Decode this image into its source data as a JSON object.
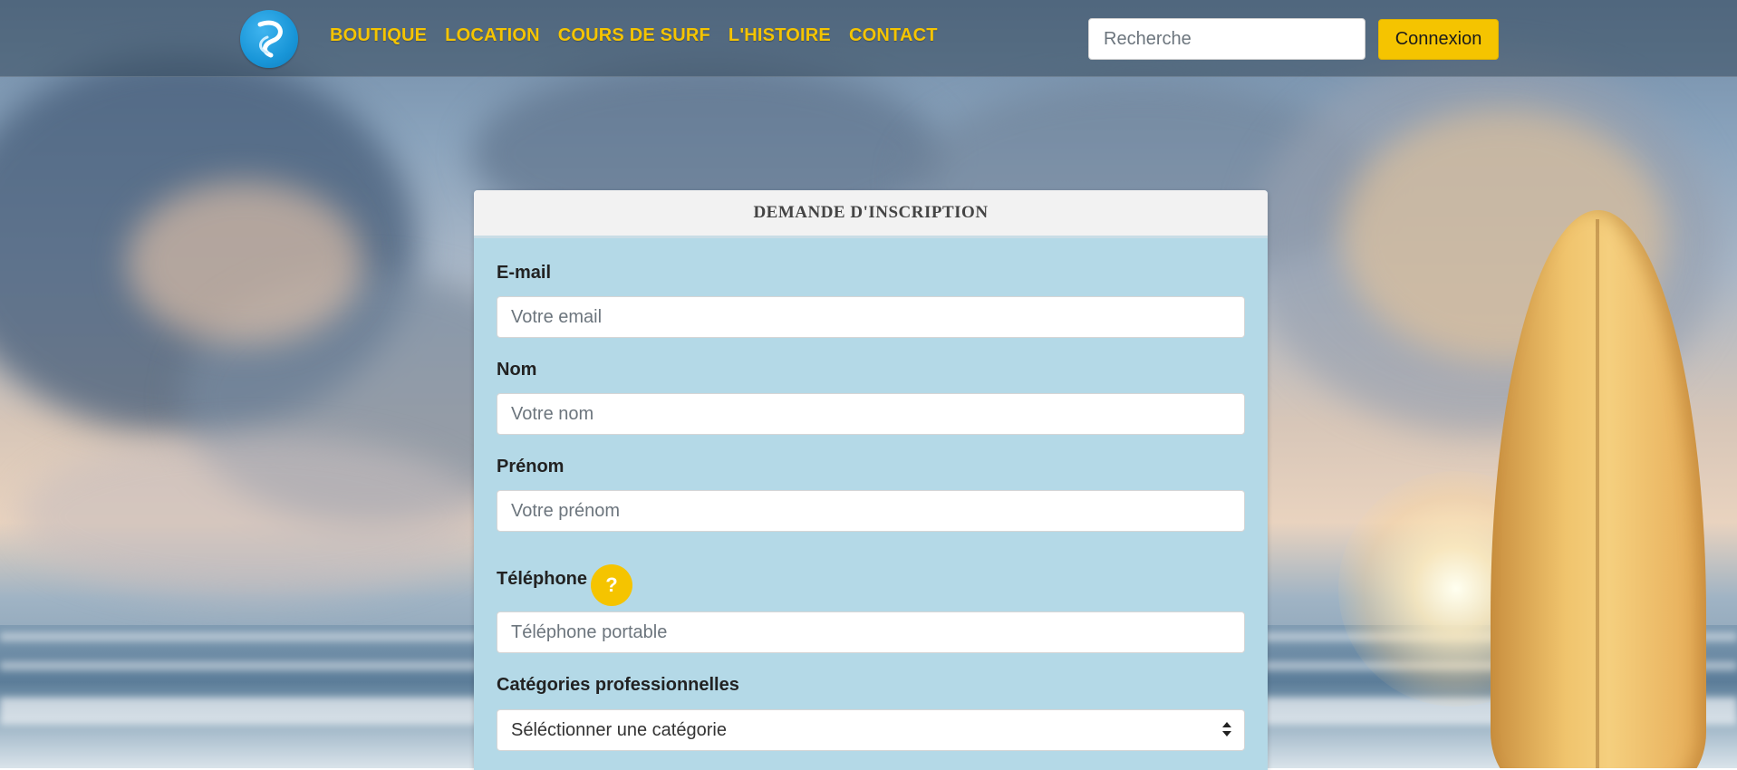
{
  "brand": {
    "accent": "#f5c400",
    "form_bg": "#b4d9e7",
    "logo_color": "#1996d8"
  },
  "nav": {
    "logo_icon": "wave-logo-icon",
    "links": [
      "BOUTIQUE",
      "LOCATION",
      "COURS DE SURF",
      "L'HISTOIRE",
      "CONTACT"
    ],
    "search_placeholder": "Recherche",
    "login_label": "Connexion"
  },
  "form": {
    "title": "DEMANDE D'INSCRIPTION",
    "fields": [
      {
        "label": "E-mail",
        "placeholder": "Votre email",
        "value": ""
      },
      {
        "label": "Nom",
        "placeholder": "Votre nom",
        "value": ""
      },
      {
        "label": "Prénom",
        "placeholder": "Votre prénom",
        "value": ""
      },
      {
        "label": "Téléphone",
        "placeholder": "Téléphone portable",
        "value": ""
      }
    ],
    "phone_help": "?",
    "category": {
      "label": "Catégories professionnelles",
      "selected": "Séléctionner une catégorie"
    }
  }
}
